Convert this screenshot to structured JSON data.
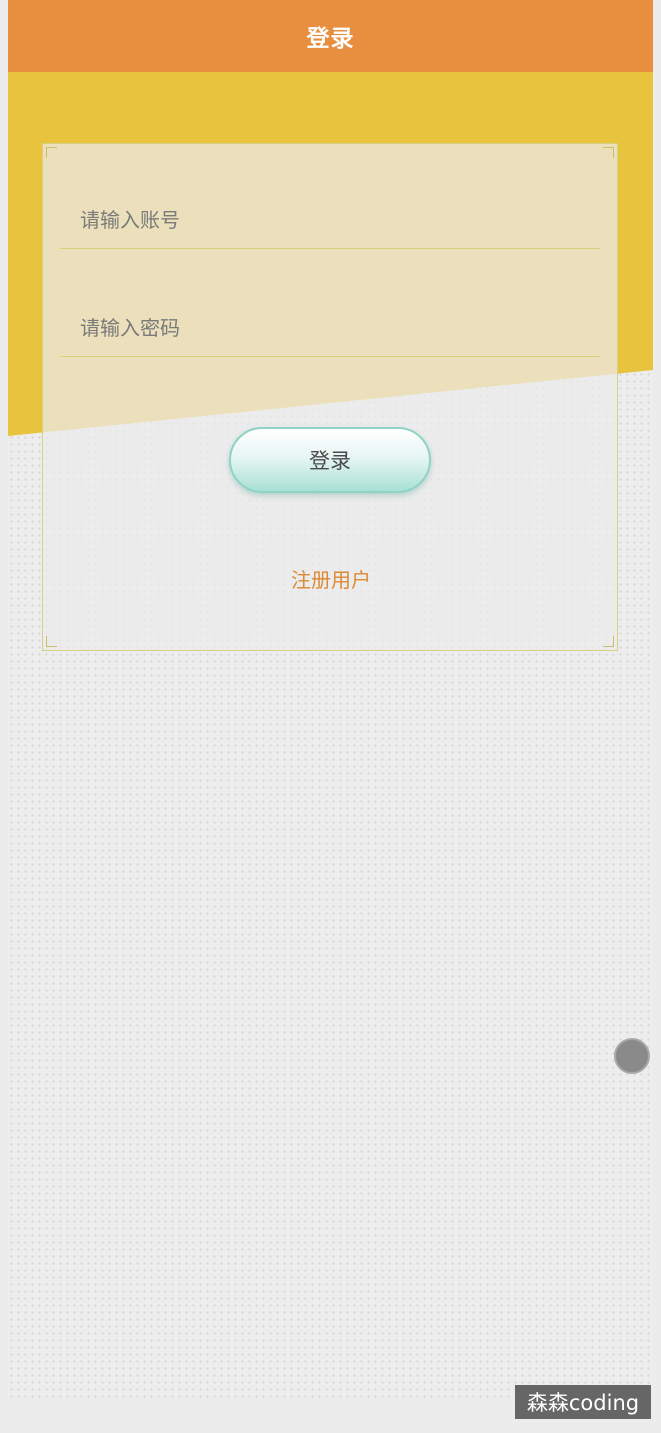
{
  "navbar": {
    "title": "登录"
  },
  "form": {
    "account_placeholder": "请输入账号",
    "password_placeholder": "请输入密码",
    "login_button_label": "登录",
    "register_link_label": "注册用户"
  },
  "watermark": {
    "text": "森森coding"
  },
  "colors": {
    "navbar": "#e88e3f",
    "header_background": "#e8c33d",
    "button_accent": "#8fd3c5",
    "register_link": "#dc8a35"
  }
}
